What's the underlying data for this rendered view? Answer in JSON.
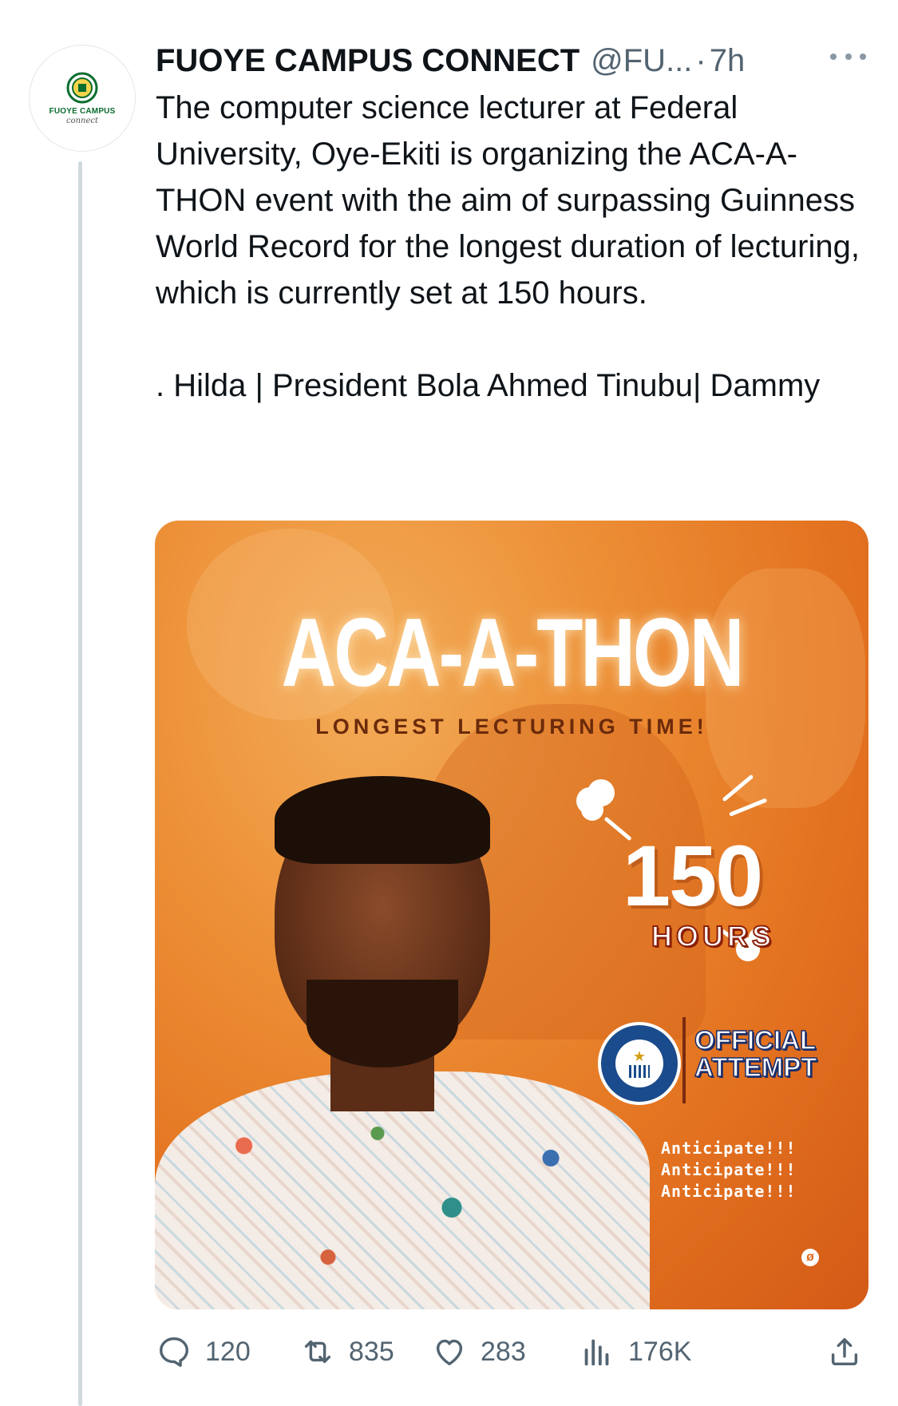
{
  "author": {
    "avatar_text": "FUOYE CAMPUS",
    "avatar_subtext": "connect",
    "name": "FUOYE CAMPUS CONNECT",
    "handle": "@FU...",
    "separator": "·",
    "time": "7h"
  },
  "tweet": {
    "lines": [
      "The computer science lecturer at Federal University, Oye-Ekiti is organizing the ACA-A-THON event with the aim of surpassing Guinness World Record for the longest duration of lecturing, which is currently set at 150 hours.",
      ". Hilda | President Bola Ahmed Tinubu| Dammy"
    ]
  },
  "media": {
    "title": "ACA-A-THON",
    "subtitle": "LONGEST LECTURING TIME!",
    "number": "150",
    "unit": "HOURS",
    "badge_text": "GUINNESS WORLD RECORDS",
    "official_line1": "OFFICIAL",
    "official_line2": "ATTEMPT",
    "anticipate": [
      "Anticipate!!!",
      "Anticipate!!!",
      "Anticipate!!!"
    ],
    "colors": {
      "bg": "#e47421",
      "accent_text": "#8a1f0a",
      "badge": "#1a4b8c"
    }
  },
  "actions": {
    "replies": "120",
    "retweets": "835",
    "likes": "283",
    "views": "176K",
    "icons": [
      "reply-icon",
      "retweet-icon",
      "like-icon",
      "views-icon",
      "share-icon"
    ]
  }
}
